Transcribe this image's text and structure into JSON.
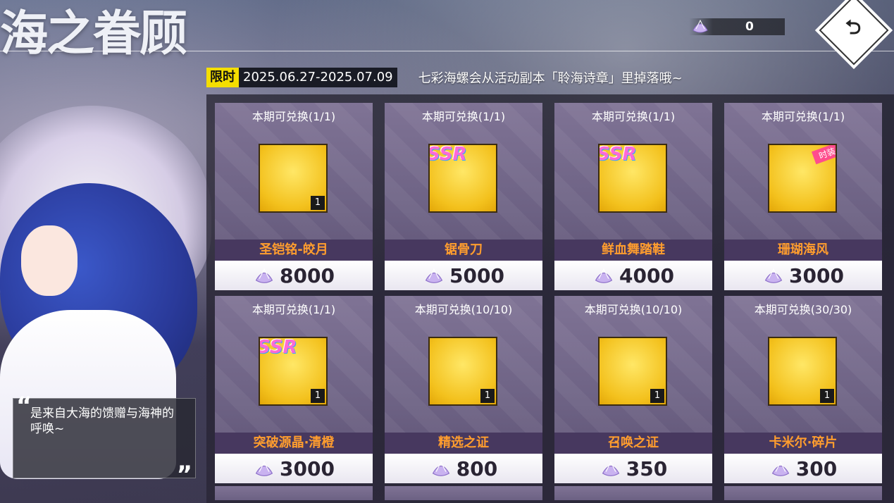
{
  "header": {
    "title": "海之眷顾",
    "currency_count": "0",
    "back_icon": "undo-arrow-icon"
  },
  "info_bar": {
    "limited_label": "限时",
    "dates": "2025.06.27-2025.07.09",
    "note": "七彩海螺会从活动副本「聆海诗章」里掉落哦~"
  },
  "character": {
    "quote": "是来自大海的馈赠与海神的呼唤~",
    "open_mark": "“",
    "close_mark": "”"
  },
  "items": [
    {
      "limit": "本期可兑换(1/1)",
      "name": "圣铠铭-皎月",
      "price": "8000",
      "qty": "1",
      "badge": "",
      "icon": "armor-medal-icon"
    },
    {
      "limit": "本期可兑换(1/1)",
      "name": "锯骨刀",
      "price": "5000",
      "qty": "",
      "badge": "SSR",
      "icon": "crossed-blades-icon"
    },
    {
      "limit": "本期可兑换(1/1)",
      "name": "鲜血舞踏鞋",
      "price": "4000",
      "qty": "",
      "badge": "SSR",
      "icon": "red-shoes-icon"
    },
    {
      "limit": "本期可兑换(1/1)",
      "name": "珊瑚海风",
      "price": "3000",
      "qty": "",
      "badge": "",
      "tag": "时装",
      "icon": "character-portrait-icon"
    },
    {
      "limit": "本期可兑换(1/1)",
      "name": "突破源晶·清橙",
      "price": "3000",
      "qty": "1",
      "badge": "SSR",
      "icon": "crystal-pendant-icon"
    },
    {
      "limit": "本期可兑换(10/10)",
      "name": "精选之证",
      "price": "800",
      "qty": "1",
      "badge": "",
      "icon": "red-ticket-icon"
    },
    {
      "limit": "本期可兑换(10/10)",
      "name": "召唤之证",
      "price": "350",
      "qty": "1",
      "badge": "",
      "icon": "blue-ticket-icon"
    },
    {
      "limit": "本期可兑换(30/30)",
      "name": "卡米尔·碎片",
      "price": "300",
      "qty": "1",
      "badge": "",
      "icon": "character-portrait-icon"
    }
  ],
  "colors": {
    "limited_bg": "#f4de00",
    "item_name": "#ff9d2e",
    "card_bg": "#6c6183"
  }
}
